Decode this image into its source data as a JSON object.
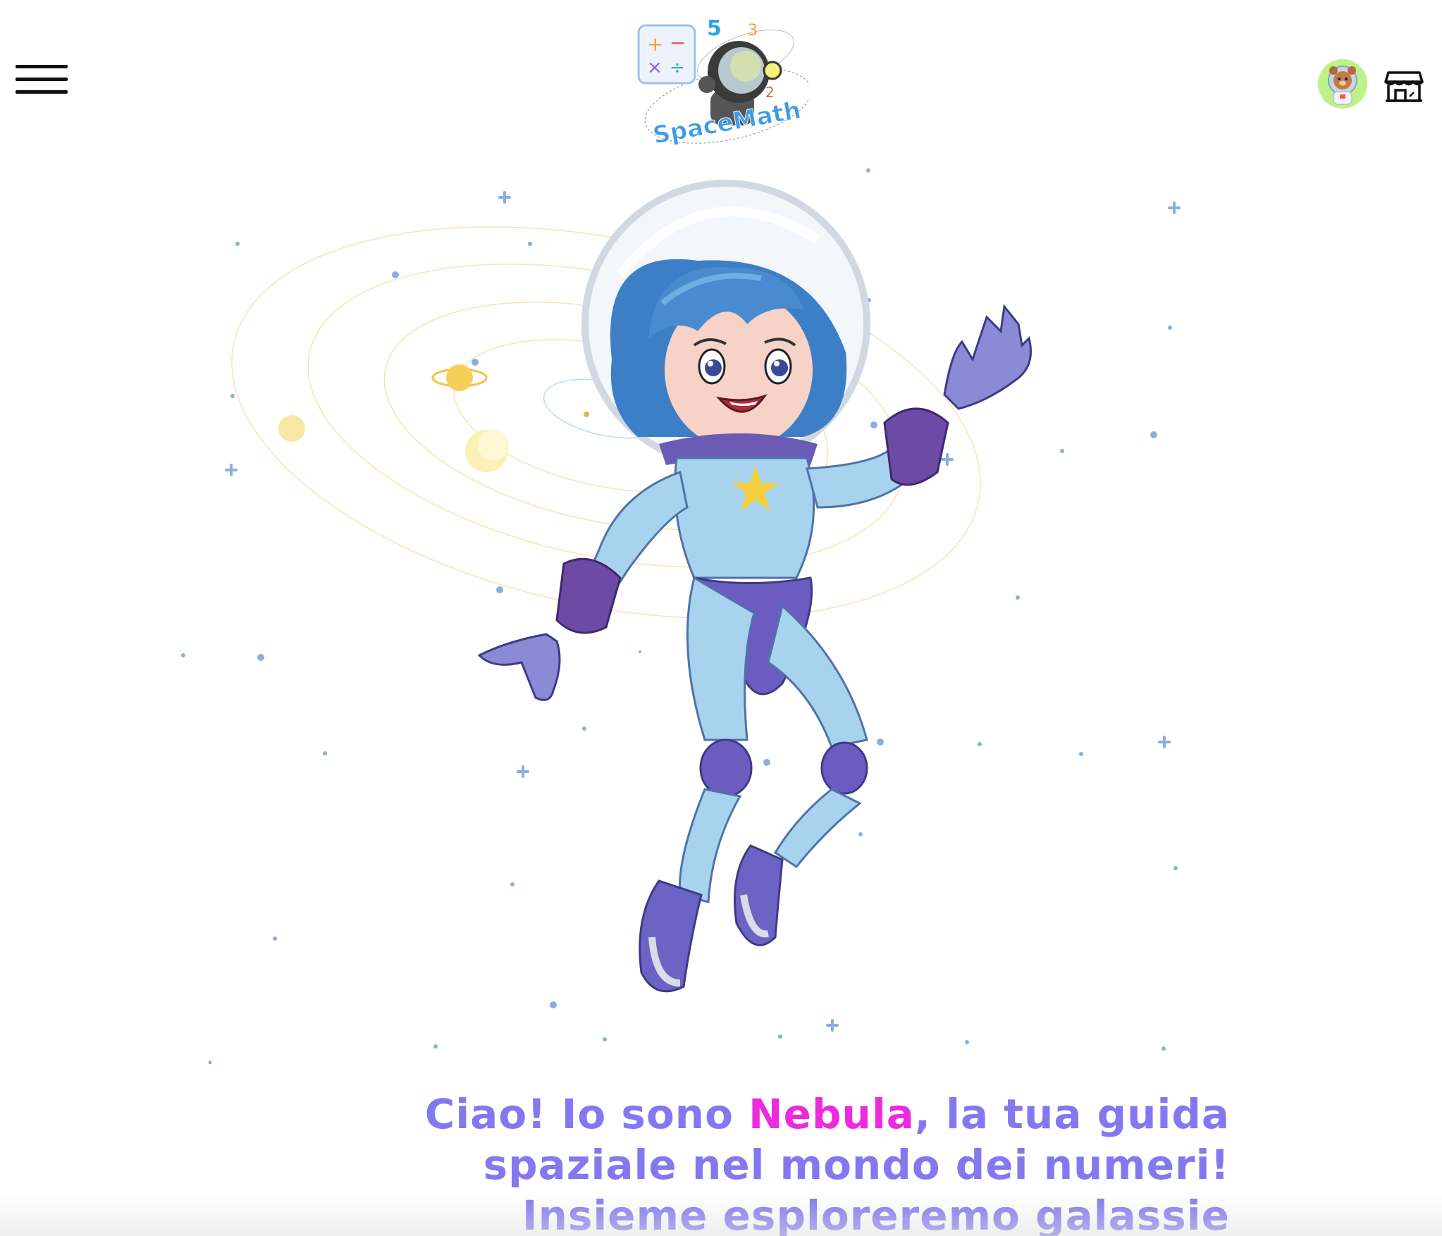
{
  "header": {
    "menu_icon": "hamburger-menu-icon",
    "logo_text": "SpaceMath",
    "avatar_icon": "bear-astronaut-avatar",
    "shop_icon": "shop-icon"
  },
  "character": {
    "icon": "astronaut-girl-illustration"
  },
  "intro": {
    "text_before": "Ciao! Io sono ",
    "name": "Nebula",
    "line1_after": ", la tua guida",
    "line2": "spaziale nel mondo dei numeri!",
    "line3": "Insieme esploreremo galassie"
  },
  "colors": {
    "text": "#8478f0",
    "highlight": "#ec2bdd",
    "avatar_bg": "#bdf28a",
    "star": "#8aaee0"
  }
}
